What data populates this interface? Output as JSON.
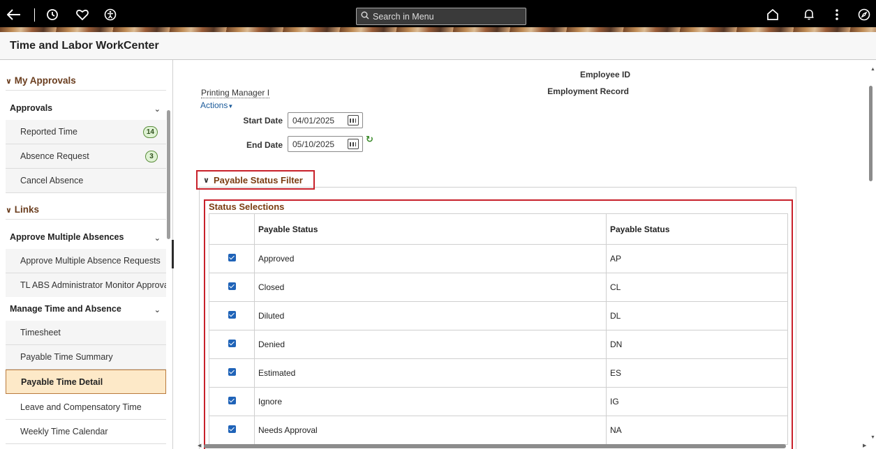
{
  "topbar": {
    "search_placeholder": "Search in Menu",
    "icons": [
      "back-arrow-icon",
      "history-icon",
      "heart-icon",
      "accessibility-icon",
      "home-icon",
      "bell-icon",
      "more-vertical-icon",
      "navigator-compass-icon"
    ]
  },
  "page": {
    "title": "Time and Labor WorkCenter"
  },
  "sidebar": {
    "sections": {
      "my_approvals": "My Approvals",
      "links": "Links"
    },
    "approvals_group": "Approvals",
    "approvals_items": [
      {
        "label": "Reported Time",
        "badge": "14"
      },
      {
        "label": "Absence Request",
        "badge": "3"
      },
      {
        "label": "Cancel Absence"
      }
    ],
    "approve_multiple_group": "Approve Multiple Absences",
    "approve_multiple_items": [
      {
        "label": "Approve Multiple Absence Requests"
      },
      {
        "label": "TL ABS Administrator Monitor Approva"
      }
    ],
    "manage_group": "Manage Time and Absence",
    "manage_items": [
      {
        "label": "Timesheet"
      },
      {
        "label": "Payable Time Summary"
      },
      {
        "label": "Payable Time Detail",
        "selected": true
      },
      {
        "label": "Leave and Compensatory Time"
      },
      {
        "label": "Weekly Time Calendar"
      }
    ]
  },
  "main": {
    "employee_name": "Printing Manager I",
    "actions_label": "Actions",
    "employee_id_label": "Employee ID",
    "employment_record_label": "Employment Record",
    "start_date_label": "Start Date",
    "start_date_value": "04/01/2025",
    "end_date_label": "End Date",
    "end_date_value": "05/10/2025",
    "filter_title": "Payable Status Filter",
    "status_selections_title": "Status Selections",
    "table": {
      "headers": [
        "Payable Status",
        "Payable Status"
      ],
      "rows": [
        {
          "checked": true,
          "description": "Approved",
          "code": "AP"
        },
        {
          "checked": true,
          "description": "Closed",
          "code": "CL"
        },
        {
          "checked": true,
          "description": "Diluted",
          "code": "DL"
        },
        {
          "checked": true,
          "description": "Denied",
          "code": "DN"
        },
        {
          "checked": true,
          "description": "Estimated",
          "code": "ES"
        },
        {
          "checked": true,
          "description": "Ignore",
          "code": "IG"
        },
        {
          "checked": true,
          "description": "Needs Approval",
          "code": "NA"
        }
      ]
    }
  },
  "colors": {
    "highlight_border": "#c8202a",
    "section_text": "#7a3d12",
    "checkbox": "#1f63b8",
    "selected_item_bg": "#fde9c8"
  }
}
